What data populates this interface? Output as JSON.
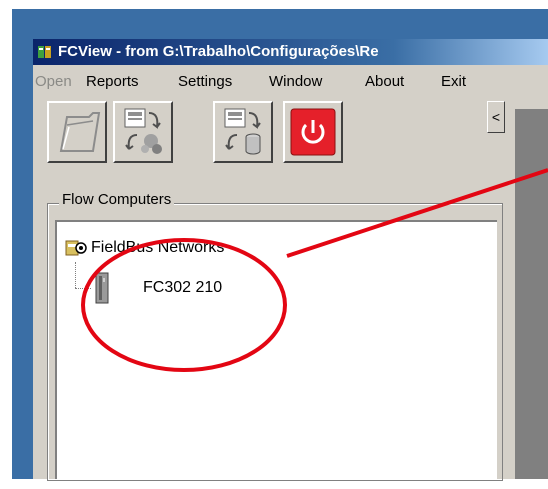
{
  "window": {
    "title": "FCView - from G:\\Trabalho\\Configurações\\Re"
  },
  "menu": {
    "open": "Open",
    "reports": "Reports",
    "settings": "Settings",
    "window": "Window",
    "about": "About",
    "exit": "Exit"
  },
  "toolbar": {
    "collapse_glyph": "<"
  },
  "tree": {
    "group_label": "Flow Computers",
    "root_label": "FieldBus Networks",
    "child_label": "FC302 210"
  },
  "colors": {
    "annotation": "#e30613",
    "exit_button": "#e5202a",
    "title_bar": "#0a246a"
  }
}
